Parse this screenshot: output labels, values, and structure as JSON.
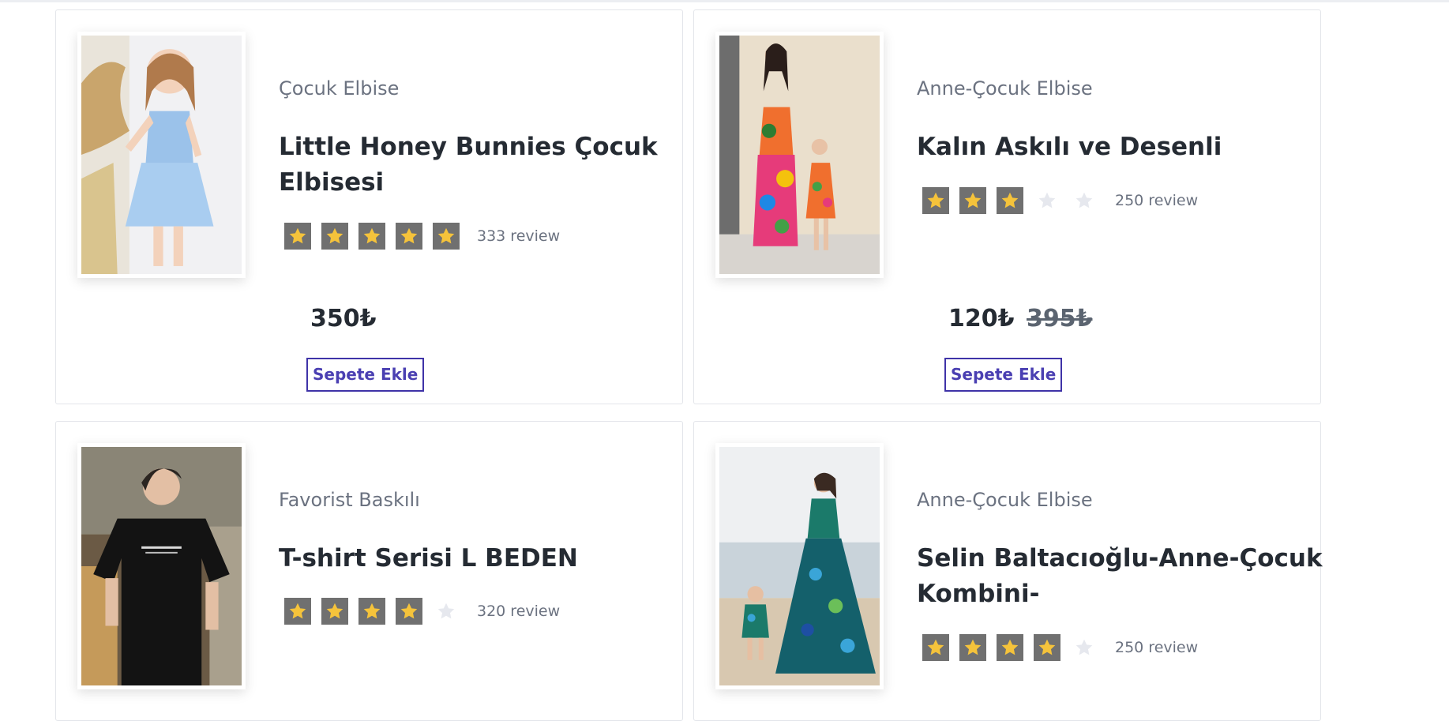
{
  "colors": {
    "star_filled": "#f5c33b",
    "star_bg": "#707070",
    "star_empty": "#e6e8ee",
    "button_border": "#3f33a8",
    "button_text": "#4a3fb2"
  },
  "products": [
    {
      "category": "Çocuk Elbise",
      "title": "Little Honey Bunnies Çocuk Elbisesi",
      "rating": 5,
      "reviews": "333 review",
      "price": "350₺",
      "old_price": "",
      "button": "Sepete Ekle"
    },
    {
      "category": "Anne-Çocuk Elbise",
      "title": "Kalın Askılı ve Desenli",
      "rating": 3,
      "reviews": "250 review",
      "price": "120₺",
      "old_price": "395₺",
      "button": "Sepete Ekle"
    },
    {
      "category": "Favorist Baskılı",
      "title": "T-shirt Serisi L BEDEN",
      "rating": 4,
      "reviews": "320 review",
      "price": "",
      "old_price": "",
      "button": ""
    },
    {
      "category": "Anne-Çocuk Elbise",
      "title": "Selin Baltacıoğlu-Anne-Çocuk Kombini-",
      "rating": 4,
      "reviews": "250 review",
      "price": "",
      "old_price": "",
      "button": ""
    }
  ]
}
